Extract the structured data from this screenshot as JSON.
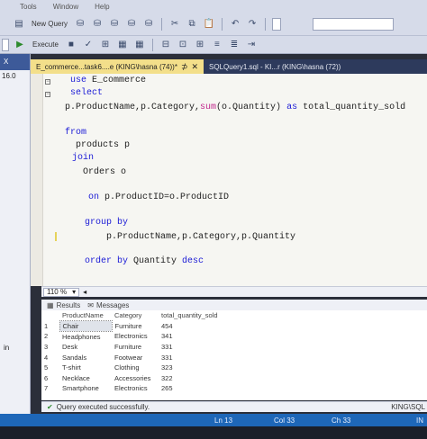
{
  "menu": {
    "items": [
      "Tools",
      "Window",
      "Help"
    ]
  },
  "toolbar": {
    "new_query_label": "New Query",
    "execute_label": "Execute"
  },
  "left_pane": {
    "badge": "X",
    "version_text": "16.0",
    "lower_text": "in"
  },
  "tabs": [
    {
      "label": "E_commerce...task6....e (KING\\hasna (74))*",
      "pin": "⊅",
      "close": "✕"
    },
    {
      "label": "SQLQuery1.sql - KI...r (KING\\hasna (72))"
    }
  ],
  "editor": {
    "lines": [
      {
        "parts": [
          {
            "t": "use ",
            "c": "kw"
          },
          {
            "t": "E_commerce",
            "c": ""
          }
        ]
      },
      {
        "parts": [
          {
            "t": "select",
            "c": "kw"
          }
        ]
      },
      {
        "parts": [
          {
            "t": "p.ProductName,p.Category,",
            "c": ""
          },
          {
            "t": "sum",
            "c": "fn"
          },
          {
            "t": "(o.Quantity) ",
            "c": ""
          },
          {
            "t": "as",
            "c": "kw"
          },
          {
            "t": " total_quantity_sold",
            "c": ""
          }
        ]
      },
      {
        "parts": [
          {
            "t": "from",
            "c": "kw"
          }
        ]
      },
      {
        "parts": [
          {
            "t": "products p",
            "c": ""
          }
        ]
      },
      {
        "parts": [
          {
            "t": "join",
            "c": "kw"
          }
        ]
      },
      {
        "parts": [
          {
            "t": "Orders o",
            "c": ""
          }
        ]
      },
      {
        "parts": [
          {
            "t": "on",
            "c": "kw"
          },
          {
            "t": " p.ProductID=o.ProductID",
            "c": ""
          }
        ]
      },
      {
        "parts": [
          {
            "t": "group by",
            "c": "kw"
          }
        ]
      },
      {
        "parts": [
          {
            "t": "p.ProductName,p.Category,p.Quantity",
            "c": ""
          }
        ]
      },
      {
        "parts": [
          {
            "t": "order by",
            "c": "kw"
          },
          {
            "t": " Quantity ",
            "c": ""
          },
          {
            "t": "desc",
            "c": "kw"
          }
        ]
      }
    ]
  },
  "zoom": {
    "value": "110 %"
  },
  "results_tabs": {
    "results": "Results",
    "messages": "Messages"
  },
  "results": {
    "columns": [
      "ProductName",
      "Category",
      "total_quantity_sold"
    ],
    "rows": [
      {
        "n": "1",
        "cells": [
          "Chair",
          "Furniture",
          "454"
        ]
      },
      {
        "n": "2",
        "cells": [
          "Headphones",
          "Electronics",
          "341"
        ]
      },
      {
        "n": "3",
        "cells": [
          "Desk",
          "Furniture",
          "331"
        ]
      },
      {
        "n": "4",
        "cells": [
          "Sandals",
          "Footwear",
          "331"
        ]
      },
      {
        "n": "5",
        "cells": [
          "T-shirt",
          "Clothing",
          "323"
        ]
      },
      {
        "n": "6",
        "cells": [
          "Necklace",
          "Accessories",
          "322"
        ]
      },
      {
        "n": "7",
        "cells": [
          "Smartphone",
          "Electronics",
          "265"
        ]
      }
    ]
  },
  "status": {
    "message": "Query executed successfully.",
    "server": "KING\\SQL",
    "ln": "Ln 13",
    "col": "Col 33",
    "ch": "Ch 33",
    "ins": "IN"
  }
}
